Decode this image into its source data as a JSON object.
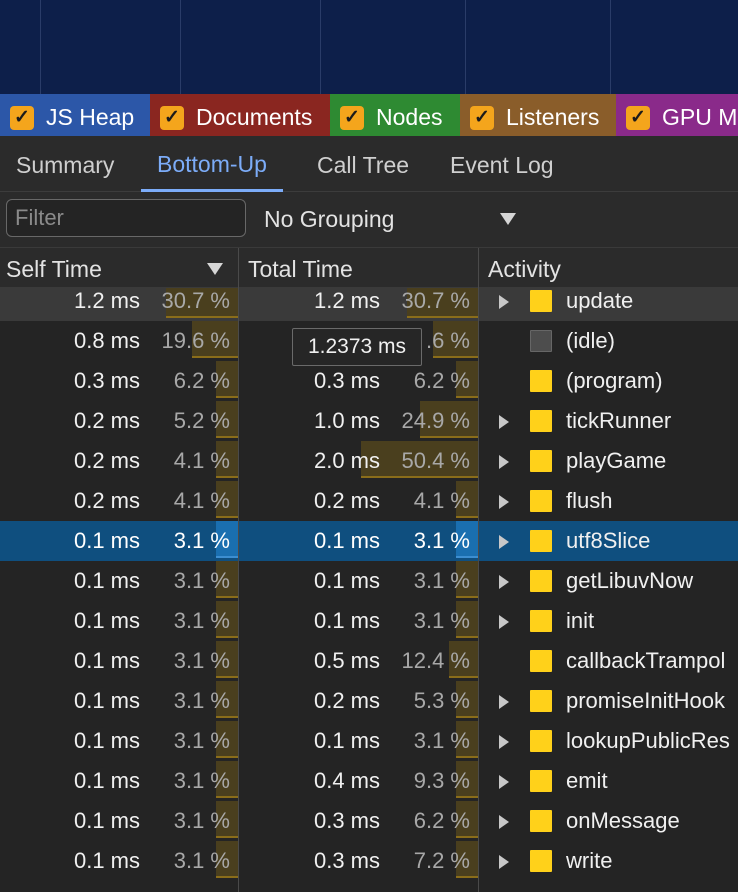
{
  "counters": [
    {
      "label": "JS Heap",
      "checked": true,
      "color": "#2c57a8"
    },
    {
      "label": "Documents",
      "checked": true,
      "color": "#8a2620"
    },
    {
      "label": "Nodes",
      "checked": true,
      "color": "#2e8a32"
    },
    {
      "label": "Listeners",
      "checked": true,
      "color": "#8a5d2a"
    },
    {
      "label": "GPU M",
      "checked": true,
      "color": "#8a2a8a"
    }
  ],
  "tabs": [
    {
      "label": "Summary"
    },
    {
      "label": "Bottom-Up",
      "active": true
    },
    {
      "label": "Call Tree"
    },
    {
      "label": "Event Log"
    }
  ],
  "filter": {
    "placeholder": "Filter",
    "value": ""
  },
  "grouping": {
    "selected": "No Grouping"
  },
  "columns": {
    "self_time": "Self Time",
    "total_time": "Total Time",
    "activity": "Activity"
  },
  "tooltip": {
    "text": "1.2373 ms"
  },
  "rows": [
    {
      "self_ms": "1.2 ms",
      "self_pct": "30.7 %",
      "self_frac": 0.307,
      "total_ms": "1.2 ms",
      "total_pct": "30.7 %",
      "total_frac": 0.307,
      "activity": "update",
      "expandable": true,
      "hover": true
    },
    {
      "self_ms": "0.8 ms",
      "self_pct": "19.6 %",
      "self_frac": 0.196,
      "total_ms": "",
      "total_pct": ".6 %",
      "total_frac": 0.196,
      "activity": "(idle)",
      "expandable": false,
      "idle": true
    },
    {
      "self_ms": "0.3 ms",
      "self_pct": "6.2 %",
      "self_frac": 0.062,
      "total_ms": "0.3 ms",
      "total_pct": "6.2 %",
      "total_frac": 0.062,
      "activity": "(program)",
      "expandable": false
    },
    {
      "self_ms": "0.2 ms",
      "self_pct": "5.2 %",
      "self_frac": 0.052,
      "total_ms": "1.0 ms",
      "total_pct": "24.9 %",
      "total_frac": 0.249,
      "activity": "tickRunner",
      "expandable": true
    },
    {
      "self_ms": "0.2 ms",
      "self_pct": "4.1 %",
      "self_frac": 0.041,
      "total_ms": "2.0 ms",
      "total_pct": "50.4 %",
      "total_frac": 0.504,
      "activity": "playGame",
      "expandable": true
    },
    {
      "self_ms": "0.2 ms",
      "self_pct": "4.1 %",
      "self_frac": 0.041,
      "total_ms": "0.2 ms",
      "total_pct": "4.1 %",
      "total_frac": 0.041,
      "activity": "flush",
      "expandable": true
    },
    {
      "self_ms": "0.1 ms",
      "self_pct": "3.1 %",
      "self_frac": 0.031,
      "total_ms": "0.1 ms",
      "total_pct": "3.1 %",
      "total_frac": 0.031,
      "activity": "utf8Slice",
      "expandable": true,
      "selected": true
    },
    {
      "self_ms": "0.1 ms",
      "self_pct": "3.1 %",
      "self_frac": 0.031,
      "total_ms": "0.1 ms",
      "total_pct": "3.1 %",
      "total_frac": 0.031,
      "activity": "getLibuvNow",
      "expandable": true
    },
    {
      "self_ms": "0.1 ms",
      "self_pct": "3.1 %",
      "self_frac": 0.031,
      "total_ms": "0.1 ms",
      "total_pct": "3.1 %",
      "total_frac": 0.031,
      "activity": "init",
      "expandable": true
    },
    {
      "self_ms": "0.1 ms",
      "self_pct": "3.1 %",
      "self_frac": 0.031,
      "total_ms": "0.5 ms",
      "total_pct": "12.4 %",
      "total_frac": 0.124,
      "activity": "callbackTrampol",
      "expandable": false
    },
    {
      "self_ms": "0.1 ms",
      "self_pct": "3.1 %",
      "self_frac": 0.031,
      "total_ms": "0.2 ms",
      "total_pct": "5.3 %",
      "total_frac": 0.053,
      "activity": "promiseInitHook",
      "expandable": true
    },
    {
      "self_ms": "0.1 ms",
      "self_pct": "3.1 %",
      "self_frac": 0.031,
      "total_ms": "0.1 ms",
      "total_pct": "3.1 %",
      "total_frac": 0.031,
      "activity": "lookupPublicRes",
      "expandable": true
    },
    {
      "self_ms": "0.1 ms",
      "self_pct": "3.1 %",
      "self_frac": 0.031,
      "total_ms": "0.4 ms",
      "total_pct": "9.3 %",
      "total_frac": 0.093,
      "activity": "emit",
      "expandable": true
    },
    {
      "self_ms": "0.1 ms",
      "self_pct": "3.1 %",
      "self_frac": 0.031,
      "total_ms": "0.3 ms",
      "total_pct": "6.2 %",
      "total_frac": 0.062,
      "activity": "onMessage",
      "expandable": true
    },
    {
      "self_ms": "0.1 ms",
      "self_pct": "3.1 %",
      "self_frac": 0.031,
      "total_ms": "0.3 ms",
      "total_pct": "7.2 %",
      "total_frac": 0.072,
      "activity": "write",
      "expandable": true
    }
  ]
}
